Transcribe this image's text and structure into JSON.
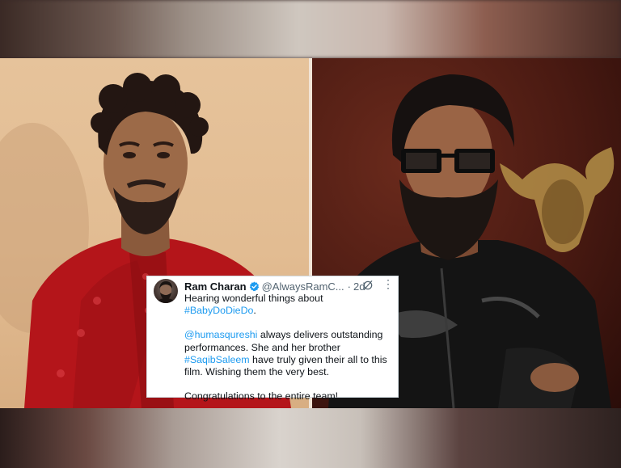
{
  "tweet": {
    "author_name": "Ram Charan",
    "handle": "@AlwaysRamC...",
    "separator": "·",
    "time": "2d",
    "more": "⋮",
    "line1": "Hearing wonderful things about",
    "hashtag1": "#BabyDoDieDo",
    "hashtag1_suffix": ".",
    "mention": "@humasqureshi",
    "text2a": " always delivers outstanding performances. She and her brother ",
    "hashtag2": "#SaqibSaleem",
    "text2b": " have truly given their all to this film. Wishing them the very best.",
    "closing": "Congratulations to the entire team!"
  },
  "icons": {
    "verified": "verified-badge-icon",
    "grok": "grok-icon",
    "more": "more-options-icon"
  },
  "colors": {
    "link": "#1d9bf0",
    "text": "#0f1419",
    "muted": "#536471",
    "verified": "#1d9bf0"
  }
}
